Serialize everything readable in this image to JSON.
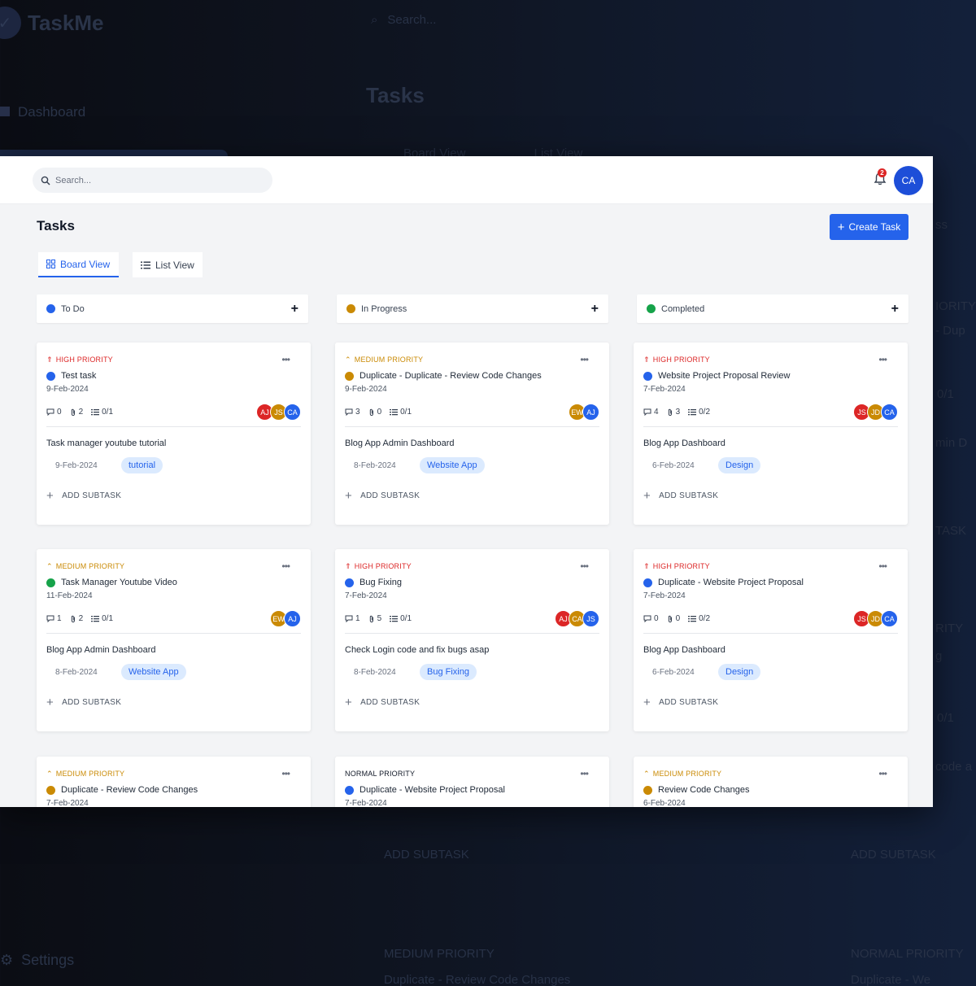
{
  "background": {
    "logo": "TaskMe",
    "search_placeholder": "Search...",
    "nav_dashboard": "Dashboard",
    "page_title": "Tasks",
    "tabs": [
      "Board View",
      "List View"
    ],
    "settings": "Settings",
    "fragments": [
      "ss",
      "IORITY",
      "- Dup",
      "0/1",
      "min D",
      "TASK",
      "RITY",
      "g",
      "0/1",
      "code a",
      "ADD SUBTASK",
      "ADD SUBTASK",
      "MEDIUM PRIORITY",
      "NORMAL PRIORITY",
      "Duplicate - Review Code Changes",
      "Duplicate - We"
    ]
  },
  "topbar": {
    "search_placeholder": "Search...",
    "notification_count": "2",
    "user_initials": "CA"
  },
  "page": {
    "title": "Tasks",
    "create_label": "Create Task",
    "tabs": [
      {
        "label": "Board View"
      },
      {
        "label": "List View"
      }
    ]
  },
  "columns": [
    {
      "label": "To Do",
      "color": "#2563eb"
    },
    {
      "label": "In Progress",
      "color": "#ca8a04"
    },
    {
      "label": "Completed",
      "color": "#16a34a"
    }
  ],
  "colors": {
    "HIGH": "#dc2626",
    "MEDIUM": "#ca8a04",
    "blue": "#2563eb",
    "yellow": "#ca8a04",
    "green": "#16a34a",
    "red": "#dc2626"
  },
  "add_subtask_label": "ADD SUBTASK",
  "cards": [
    {
      "priority": "HIGH PRIORITY",
      "level": "high",
      "title": "Test task",
      "dot": "#2563eb",
      "date": "9-Feb-2024",
      "comments": "0",
      "attachments": "2",
      "subtasks": "0/1",
      "avatars": [
        {
          "i": "AJ",
          "c": "#dc2626"
        },
        {
          "i": "JS",
          "c": "#ca8a04"
        },
        {
          "i": "CA",
          "c": "#2563eb"
        }
      ],
      "sub_title": "Task manager youtube tutorial",
      "sub_date": "9-Feb-2024",
      "tag": "tutorial"
    },
    {
      "priority": "MEDIUM PRIORITY",
      "level": "medium",
      "title": "Duplicate - Duplicate - Review Code Changes",
      "dot": "#ca8a04",
      "date": "9-Feb-2024",
      "comments": "3",
      "attachments": "0",
      "subtasks": "0/1",
      "avatars": [
        {
          "i": "EW",
          "c": "#ca8a04"
        },
        {
          "i": "AJ",
          "c": "#2563eb"
        }
      ],
      "sub_title": "Blog App Admin Dashboard",
      "sub_date": "8-Feb-2024",
      "tag": "Website App"
    },
    {
      "priority": "HIGH PRIORITY",
      "level": "high",
      "title": "Website Project Proposal Review",
      "dot": "#2563eb",
      "date": "7-Feb-2024",
      "comments": "4",
      "attachments": "3",
      "subtasks": "0/2",
      "avatars": [
        {
          "i": "JS",
          "c": "#dc2626"
        },
        {
          "i": "JD",
          "c": "#ca8a04"
        },
        {
          "i": "CA",
          "c": "#2563eb"
        }
      ],
      "sub_title": "Blog App Dashboard",
      "sub_date": "6-Feb-2024",
      "tag": "Design"
    },
    {
      "priority": "MEDIUM PRIORITY",
      "level": "medium",
      "title": "Task Manager Youtube Video",
      "dot": "#16a34a",
      "date": "11-Feb-2024",
      "comments": "1",
      "attachments": "2",
      "subtasks": "0/1",
      "avatars": [
        {
          "i": "EW",
          "c": "#ca8a04"
        },
        {
          "i": "AJ",
          "c": "#2563eb"
        }
      ],
      "sub_title": "Blog App Admin Dashboard",
      "sub_date": "8-Feb-2024",
      "tag": "Website App"
    },
    {
      "priority": "HIGH PRIORITY",
      "level": "high",
      "title": "Bug Fixing",
      "dot": "#2563eb",
      "date": "7-Feb-2024",
      "comments": "1",
      "attachments": "5",
      "subtasks": "0/1",
      "avatars": [
        {
          "i": "AJ",
          "c": "#dc2626"
        },
        {
          "i": "CA",
          "c": "#ca8a04"
        },
        {
          "i": "JS",
          "c": "#2563eb"
        }
      ],
      "sub_title": "Check Login code and fix bugs asap",
      "sub_date": "8-Feb-2024",
      "tag": "Bug Fixing"
    },
    {
      "priority": "HIGH PRIORITY",
      "level": "high",
      "title": "Duplicate - Website Project Proposal",
      "dot": "#2563eb",
      "date": "7-Feb-2024",
      "comments": "0",
      "attachments": "0",
      "subtasks": "0/2",
      "avatars": [
        {
          "i": "JS",
          "c": "#dc2626"
        },
        {
          "i": "JD",
          "c": "#ca8a04"
        },
        {
          "i": "CA",
          "c": "#2563eb"
        }
      ],
      "sub_title": "Blog App Dashboard",
      "sub_date": "6-Feb-2024",
      "tag": "Design"
    },
    {
      "priority": "MEDIUM PRIORITY",
      "level": "medium",
      "title": "Duplicate - Review Code Changes",
      "dot": "#ca8a04",
      "date": "7-Feb-2024"
    },
    {
      "priority": "NORMAL PRIORITY",
      "level": "normal",
      "title": "Duplicate - Website Project Proposal",
      "dot": "#2563eb",
      "date": "7-Feb-2024"
    },
    {
      "priority": "MEDIUM PRIORITY",
      "level": "medium",
      "title": "Review Code Changes",
      "dot": "#ca8a04",
      "date": "6-Feb-2024"
    }
  ]
}
